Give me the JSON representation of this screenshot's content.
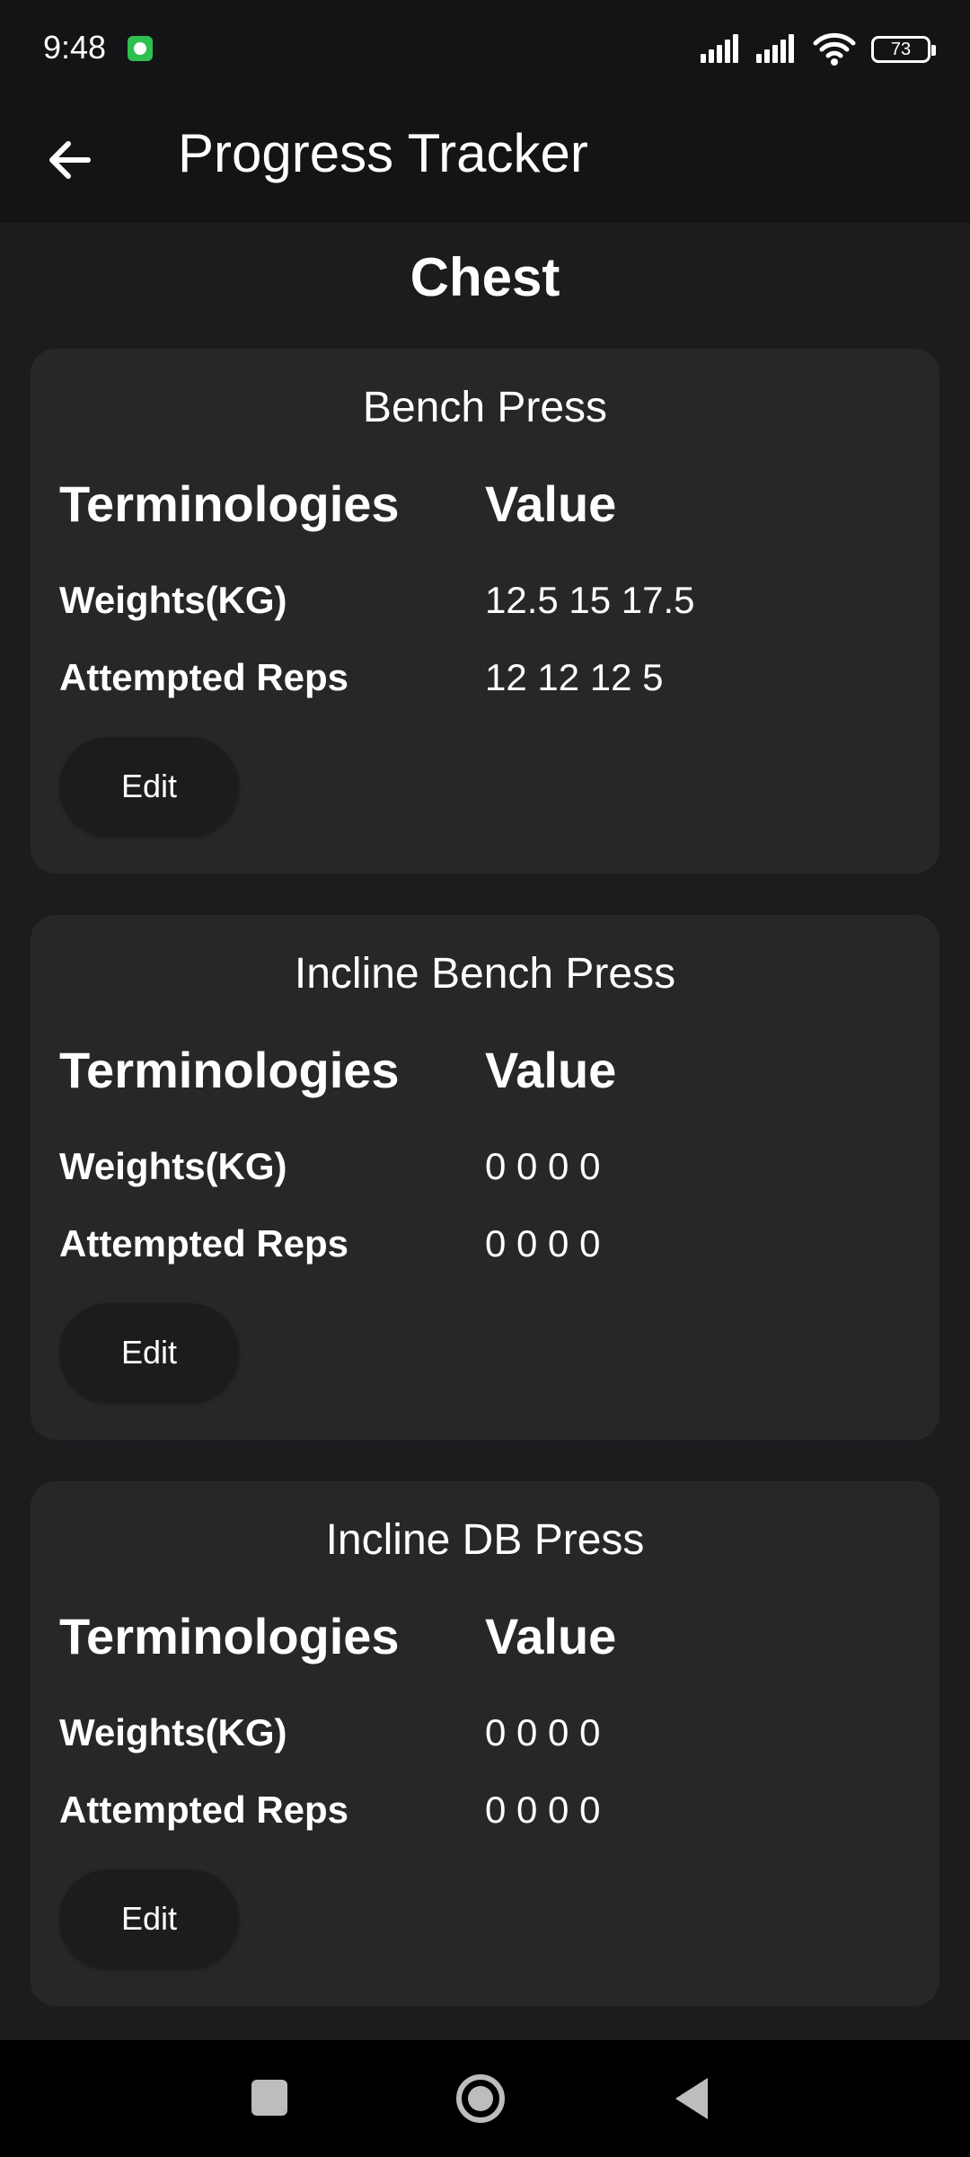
{
  "status_bar": {
    "time": "9:48",
    "battery": "73",
    "app_icon": "app-notification-icon",
    "signal_icon": "signal-icon",
    "wifi_icon": "wifi-icon"
  },
  "app_bar": {
    "title": "Progress Tracker",
    "back_icon": "arrow-back-icon"
  },
  "section": {
    "title": "Chest"
  },
  "cards": [
    {
      "title": "Bench Press",
      "col_term": "Terminologies",
      "col_value": "Value",
      "rows": [
        {
          "label": "Weights(KG)",
          "value": "12.5 15 17.5"
        },
        {
          "label": "Attempted Reps",
          "value": "12 12 12 5"
        }
      ],
      "edit_label": "Edit"
    },
    {
      "title": "Incline Bench Press",
      "col_term": "Terminologies",
      "col_value": "Value",
      "rows": [
        {
          "label": "Weights(KG)",
          "value": "0 0 0 0"
        },
        {
          "label": "Attempted Reps",
          "value": "0 0 0 0"
        }
      ],
      "edit_label": "Edit"
    },
    {
      "title": "Incline DB Press",
      "col_term": "Terminologies",
      "col_value": "Value",
      "rows": [
        {
          "label": "Weights(KG)",
          "value": "0 0 0 0"
        },
        {
          "label": "Attempted Reps",
          "value": "0 0 0 0"
        }
      ],
      "edit_label": "Edit"
    }
  ],
  "nav_bar": {
    "recents_icon": "square-recents-icon",
    "home_icon": "circle-home-icon",
    "back_icon": "triangle-back-icon"
  },
  "colors": {
    "background": "#1c1c1f",
    "app_bar": "#141416",
    "card": "#272729",
    "button": "#1c1c1d",
    "text": "#ffffff"
  }
}
